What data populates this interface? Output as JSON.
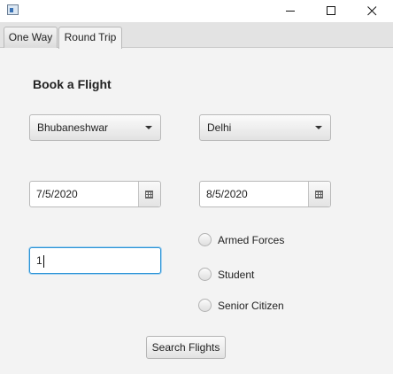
{
  "window": {
    "icon": "app-window-icon",
    "controls": [
      "minimize-icon",
      "maximize-icon",
      "close-icon"
    ]
  },
  "tabs": [
    {
      "label": "One Way",
      "active": false
    },
    {
      "label": "Round Trip",
      "active": true
    }
  ],
  "form": {
    "heading": "Book a Flight",
    "from_city": "Bhubaneshwar",
    "to_city": "Delhi",
    "depart_date": "7/5/2020",
    "return_date": "8/5/2020",
    "passengers": "1",
    "concessions": [
      {
        "label": "Armed Forces",
        "selected": false
      },
      {
        "label": "Student",
        "selected": false
      },
      {
        "label": "Senior Citizen",
        "selected": false
      }
    ],
    "search_label": "Search Flights"
  },
  "colors": {
    "background": "#f3f3f3",
    "focus_border": "#2b93d6"
  }
}
